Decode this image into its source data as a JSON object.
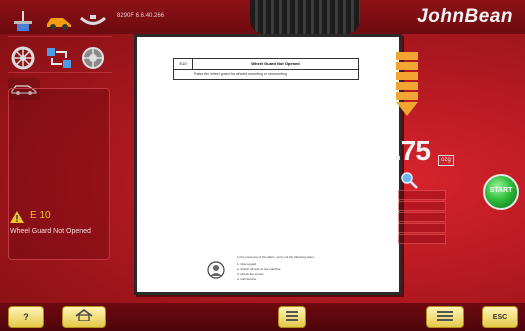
{
  "app": {
    "brand": "JohnBean",
    "top_info": "8290F   6.6.40.266"
  },
  "warning": {
    "code": "E 10",
    "message": "Wheel Guard Not Opened"
  },
  "dialog": {
    "table_code": "E10",
    "table_title": "Wheel Guard Not Opened",
    "table_desc": "Raise the wheel guard for wheels mounting or unmounting",
    "footer_lines": [
      "In the presence of this alarm, carry out the following steps:",
      "1.   Open guard",
      "2.   Switch off and on the machine",
      "3.   Check the sensor",
      "4.   Call Service"
    ]
  },
  "readout": {
    "value": ".75",
    "unit": "ozg"
  },
  "start_button": {
    "label": "START"
  },
  "bottom": {
    "help_label": "?",
    "esc_label": "ESC"
  },
  "icons": {
    "top_row": [
      "balancer-arm-icon",
      "car-icon",
      "weight-icon"
    ],
    "second_row": [
      "wheel-icon",
      "swap-icon",
      "wheel-gear-icon"
    ],
    "third_row": [
      "car-outline-icon"
    ],
    "warning_icon": "warning-triangle-icon",
    "home_icon": "home-icon"
  },
  "colors": {
    "background_red": "#b01820",
    "accent_yellow": "#f1c232",
    "start_green": "#2fbf3b"
  }
}
